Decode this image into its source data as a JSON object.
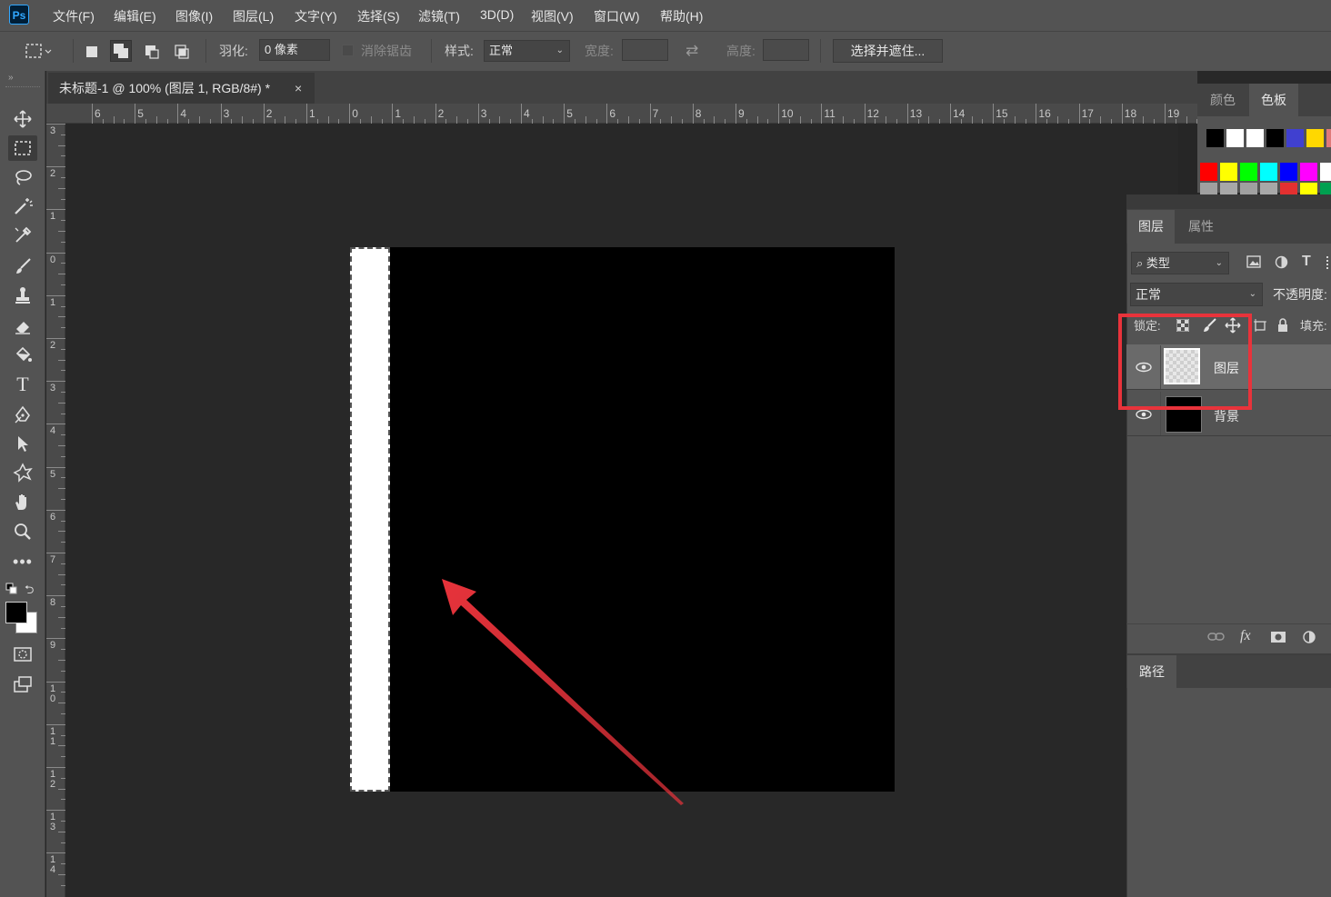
{
  "app": {
    "logo": "Ps"
  },
  "menu": [
    "文件(F)",
    "编辑(E)",
    "图像(I)",
    "图层(L)",
    "文字(Y)",
    "选择(S)",
    "滤镜(T)",
    "3D(D)",
    "视图(V)",
    "窗口(W)",
    "帮助(H)"
  ],
  "options": {
    "feather_label": "羽化:",
    "feather_value": "0 像素",
    "antialias_label": "消除锯齿",
    "style_label": "样式:",
    "style_value": "正常",
    "width_label": "宽度:",
    "height_label": "高度:",
    "select_mask_button": "选择并遮住..."
  },
  "document": {
    "tab_title": "未标题-1 @ 100% (图层 1, RGB/8#) *",
    "close": "×"
  },
  "ruler": {
    "h_labels": [
      "6",
      "5",
      "4",
      "3",
      "2",
      "1",
      "0",
      "1",
      "2",
      "3",
      "4",
      "5",
      "6",
      "7",
      "8",
      "9",
      "10",
      "11",
      "12",
      "13",
      "14",
      "15",
      "16",
      "17",
      "18",
      "19"
    ],
    "v_labels": [
      "3",
      "2",
      "1",
      "0",
      "1",
      "2",
      "3",
      "4",
      "5",
      "6",
      "7",
      "8",
      "9",
      "1\n0",
      "1\n1",
      "1\n2",
      "1\n3",
      "1\n4"
    ]
  },
  "swatches_panel": {
    "tabs": [
      "颜色",
      "色板"
    ],
    "row1": [
      "#000000",
      "#ffffff",
      "#ffffff",
      "#000000",
      "#4040d0",
      "#ffd800",
      "#e07a7a"
    ],
    "row2": [
      "#ff0000",
      "#ffff00",
      "#00ff00",
      "#00ffff",
      "#0000ff",
      "#ff00ff",
      "#ffffff"
    ],
    "row3": [
      "#a0a0a0",
      "#a8a8a8",
      "#a0a0a0",
      "#a8a8a8",
      "#e33030",
      "#ffff00",
      "#00a050"
    ]
  },
  "layers_panel": {
    "tabs": [
      "图层",
      "属性"
    ],
    "filter_label": "类型",
    "blend_mode": "正常",
    "opacity_label": "不透明度:",
    "lock_label": "锁定:",
    "fill_label": "填充:",
    "layers": [
      {
        "name": "图层",
        "selected": true
      },
      {
        "name": "背景",
        "selected": false
      }
    ],
    "fx_label": "fx"
  },
  "paths_panel": {
    "tab": "路径"
  },
  "colors": {
    "highlight": "#e8333b",
    "arrow": "#e8333b"
  }
}
